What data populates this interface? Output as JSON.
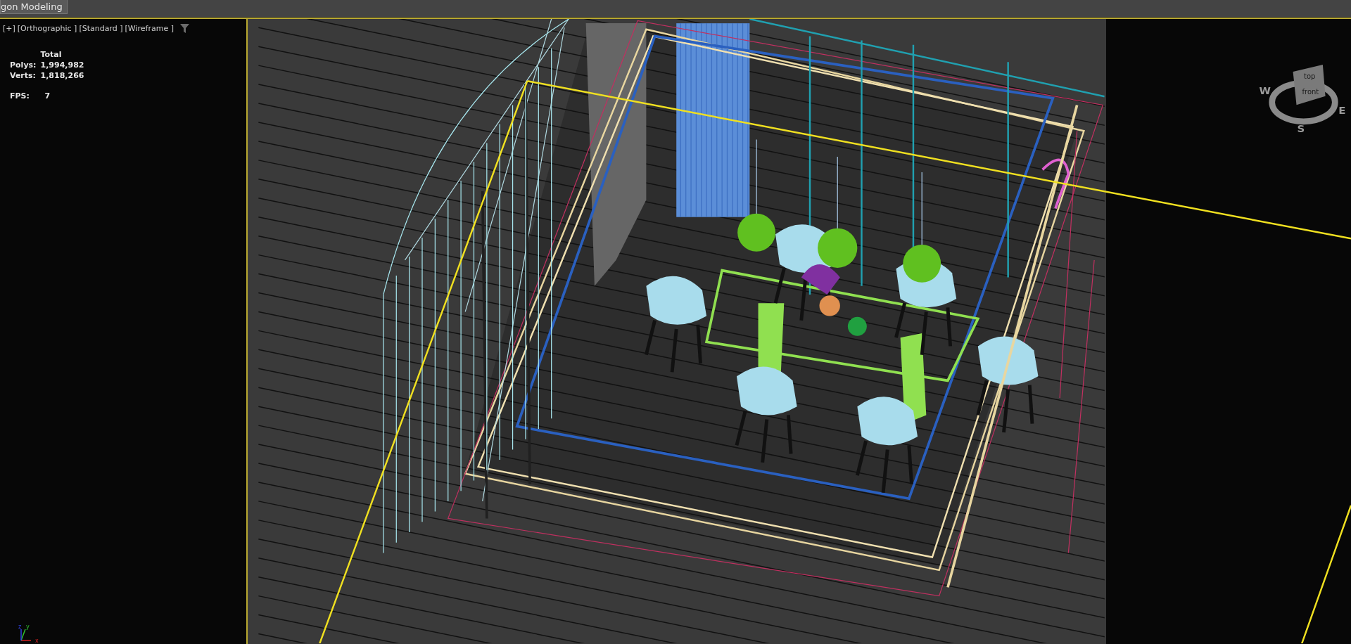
{
  "tab": {
    "label": "gon Modeling"
  },
  "viewport": {
    "menus": [
      "[+]",
      "[Orthographic ]",
      "[Standard ]",
      "[Wireframe ]"
    ]
  },
  "stats": {
    "heading": "Total",
    "rows": [
      {
        "label": "Polys:",
        "value": "1,994,982"
      },
      {
        "label": "Verts:",
        "value": "1,818,266"
      }
    ],
    "fps": {
      "label": "FPS:",
      "value": "7"
    }
  },
  "viewcube": {
    "faces": [
      "top",
      "front"
    ],
    "compass": [
      "W",
      "E",
      "S"
    ]
  },
  "axis": [
    "x",
    "y",
    "z"
  ]
}
